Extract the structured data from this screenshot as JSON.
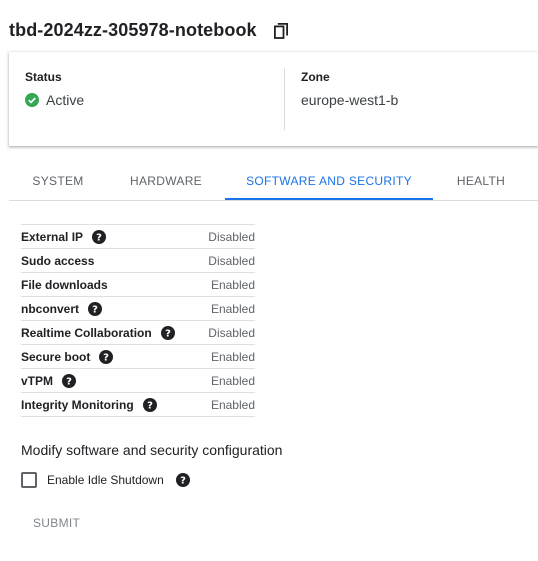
{
  "header": {
    "title": "tbd-2024zz-305978-notebook",
    "copy_icon": "copy-icon"
  },
  "summary": {
    "status_label": "Status",
    "status_value": "Active",
    "status_icon": "check-circle-icon",
    "status_color": "#34a853",
    "zone_label": "Zone",
    "zone_value": "europe-west1-b"
  },
  "tabs": [
    {
      "label": "SYSTEM",
      "active": false
    },
    {
      "label": "HARDWARE",
      "active": false
    },
    {
      "label": "SOFTWARE AND SECURITY",
      "active": true
    },
    {
      "label": "HEALTH",
      "active": false
    }
  ],
  "properties": [
    {
      "label": "External IP",
      "value": "Disabled",
      "help": true
    },
    {
      "label": "Sudo access",
      "value": "Disabled",
      "help": false
    },
    {
      "label": "File downloads",
      "value": "Enabled",
      "help": false
    },
    {
      "label": "nbconvert",
      "value": "Enabled",
      "help": true
    },
    {
      "label": "Realtime Collaboration",
      "value": "Disabled",
      "help": true
    },
    {
      "label": "Secure boot",
      "value": "Enabled",
      "help": true
    },
    {
      "label": "vTPM",
      "value": "Enabled",
      "help": true
    },
    {
      "label": "Integrity Monitoring",
      "value": "Enabled",
      "help": true
    }
  ],
  "modify": {
    "title": "Modify software and security configuration",
    "idle_shutdown_label": "Enable Idle Shutdown",
    "idle_shutdown_checked": false,
    "submit_label": "SUBMIT"
  },
  "colors": {
    "accent": "#1a73e8",
    "text": "#202124",
    "muted": "#5f6368"
  }
}
